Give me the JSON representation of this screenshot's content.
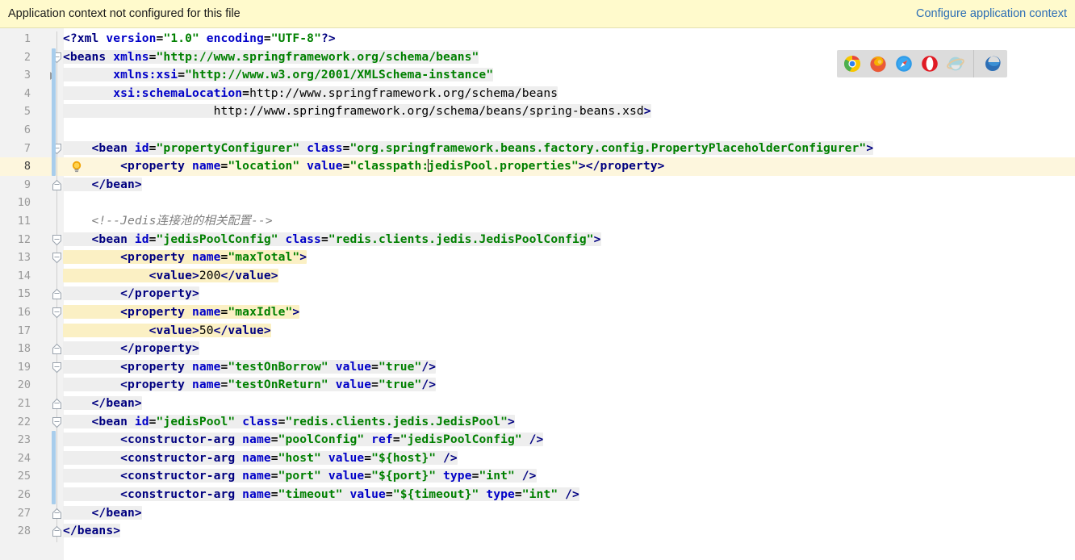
{
  "banner": {
    "message": "Application context not configured for this file",
    "action_label": "Configure application context"
  },
  "editor": {
    "current_line": 8,
    "caret_line": 8,
    "colors": {
      "tag": "#000080",
      "attribute": "#0000c8",
      "value": "#008000",
      "comment": "#808080",
      "current_line_bg": "#fdf6dd",
      "banner_bg": "#fffacc",
      "link": "#2d6eb5",
      "change_bar": "#a8cdec"
    },
    "line_numbers": [
      1,
      2,
      3,
      4,
      5,
      6,
      7,
      8,
      9,
      10,
      11,
      12,
      13,
      14,
      15,
      16,
      17,
      18,
      19,
      20,
      21,
      22,
      23,
      24,
      25,
      26,
      27,
      28
    ],
    "lines": [
      {
        "n": 1,
        "text": "<?xml version=\"1.0\" encoding=\"UTF-8\"?>"
      },
      {
        "n": 2,
        "text": "<beans xmlns=\"http://www.springframework.org/schema/beans\""
      },
      {
        "n": 3,
        "text": "       xmlns:xsi=\"http://www.w3.org/2001/XMLSchema-instance\""
      },
      {
        "n": 4,
        "text": "       xsi:schemaLocation=\"http://www.springframework.org/schema/beans"
      },
      {
        "n": 5,
        "text": "                     http://www.springframework.org/schema/beans/spring-beans.xsd\">"
      },
      {
        "n": 6,
        "text": ""
      },
      {
        "n": 7,
        "text": "    <bean id=\"propertyConfigurer\" class=\"org.springframework.beans.factory.config.PropertyPlaceholderConfigurer\">"
      },
      {
        "n": 8,
        "text": "        <property name=\"location\" value=\"classpath:jedisPool.properties\"></property>"
      },
      {
        "n": 9,
        "text": "    </bean>"
      },
      {
        "n": 10,
        "text": ""
      },
      {
        "n": 11,
        "text": "    <!--Jedis连接池的相关配置-->"
      },
      {
        "n": 12,
        "text": "    <bean id=\"jedisPoolConfig\" class=\"redis.clients.jedis.JedisPoolConfig\">"
      },
      {
        "n": 13,
        "text": "        <property name=\"maxTotal\">"
      },
      {
        "n": 14,
        "text": "            <value>200</value>"
      },
      {
        "n": 15,
        "text": "        </property>"
      },
      {
        "n": 16,
        "text": "        <property name=\"maxIdle\">"
      },
      {
        "n": 17,
        "text": "            <value>50</value>"
      },
      {
        "n": 18,
        "text": "        </property>"
      },
      {
        "n": 19,
        "text": "        <property name=\"testOnBorrow\" value=\"true\"/>"
      },
      {
        "n": 20,
        "text": "        <property name=\"testOnReturn\" value=\"true\"/>"
      },
      {
        "n": 21,
        "text": "    </bean>"
      },
      {
        "n": 22,
        "text": "    <bean id=\"jedisPool\" class=\"redis.clients.jedis.JedisPool\">"
      },
      {
        "n": 23,
        "text": "        <constructor-arg name=\"poolConfig\" ref=\"jedisPoolConfig\" />"
      },
      {
        "n": 24,
        "text": "        <constructor-arg name=\"host\" value=\"${host}\" />"
      },
      {
        "n": 25,
        "text": "        <constructor-arg name=\"port\" value=\"${port}\" type=\"int\" />"
      },
      {
        "n": 26,
        "text": "        <constructor-arg name=\"timeout\" value=\"${timeout}\" type=\"int\" />"
      },
      {
        "n": 27,
        "text": "    </bean>"
      },
      {
        "n": 28,
        "text": "</beans>"
      }
    ]
  },
  "gutter": {
    "intention_bulb_line": 8,
    "expand_arrow_line": 3,
    "change_bar_ranges": [
      [
        2,
        8
      ],
      [
        23,
        26
      ]
    ]
  },
  "browser_popup": {
    "browsers": [
      {
        "name": "chrome",
        "label": "Chrome",
        "dim": false
      },
      {
        "name": "firefox",
        "label": "Firefox",
        "dim": false
      },
      {
        "name": "safari",
        "label": "Safari",
        "dim": false
      },
      {
        "name": "opera",
        "label": "Opera",
        "dim": false
      },
      {
        "name": "ie",
        "label": "Internet Explorer",
        "dim": true
      },
      {
        "name": "edge",
        "label": "Edge",
        "dim": false
      }
    ]
  }
}
